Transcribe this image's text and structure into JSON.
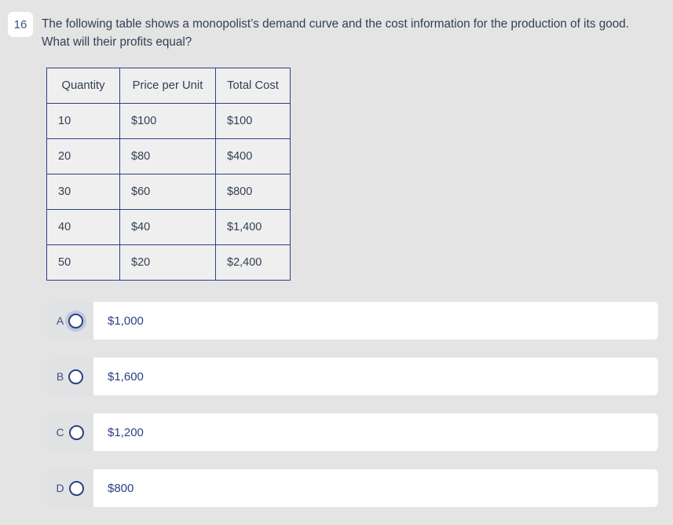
{
  "question": {
    "number": "16",
    "text": "The following table shows a monopolist’s demand curve and the cost information for the production of its good. What will their profits equal?"
  },
  "table": {
    "headers": [
      "Quantity",
      "Price per Unit",
      "Total Cost"
    ],
    "rows": [
      [
        "10",
        "$100",
        "$100"
      ],
      [
        "20",
        "$80",
        "$400"
      ],
      [
        "30",
        "$60",
        "$800"
      ],
      [
        "40",
        "$40",
        "$1,400"
      ],
      [
        "50",
        "$20",
        "$2,400"
      ]
    ]
  },
  "options": [
    {
      "letter": "A",
      "value": "$1,000",
      "selected": false,
      "focused": true
    },
    {
      "letter": "B",
      "value": "$1,600",
      "selected": false,
      "focused": false
    },
    {
      "letter": "C",
      "value": "$1,200",
      "selected": false,
      "focused": false
    },
    {
      "letter": "D",
      "value": "$800",
      "selected": false,
      "focused": false
    }
  ],
  "colors": {
    "page_background": "#e4e4e5",
    "table_border": "#2c4183",
    "table_cell_background": "#efeff0",
    "question_text": "#323f52",
    "option_background": "#ffffff",
    "option_prefix_background": "#e1e2e4",
    "accent_navy": "#2c4183",
    "focus_ring": "#c3c8de"
  }
}
